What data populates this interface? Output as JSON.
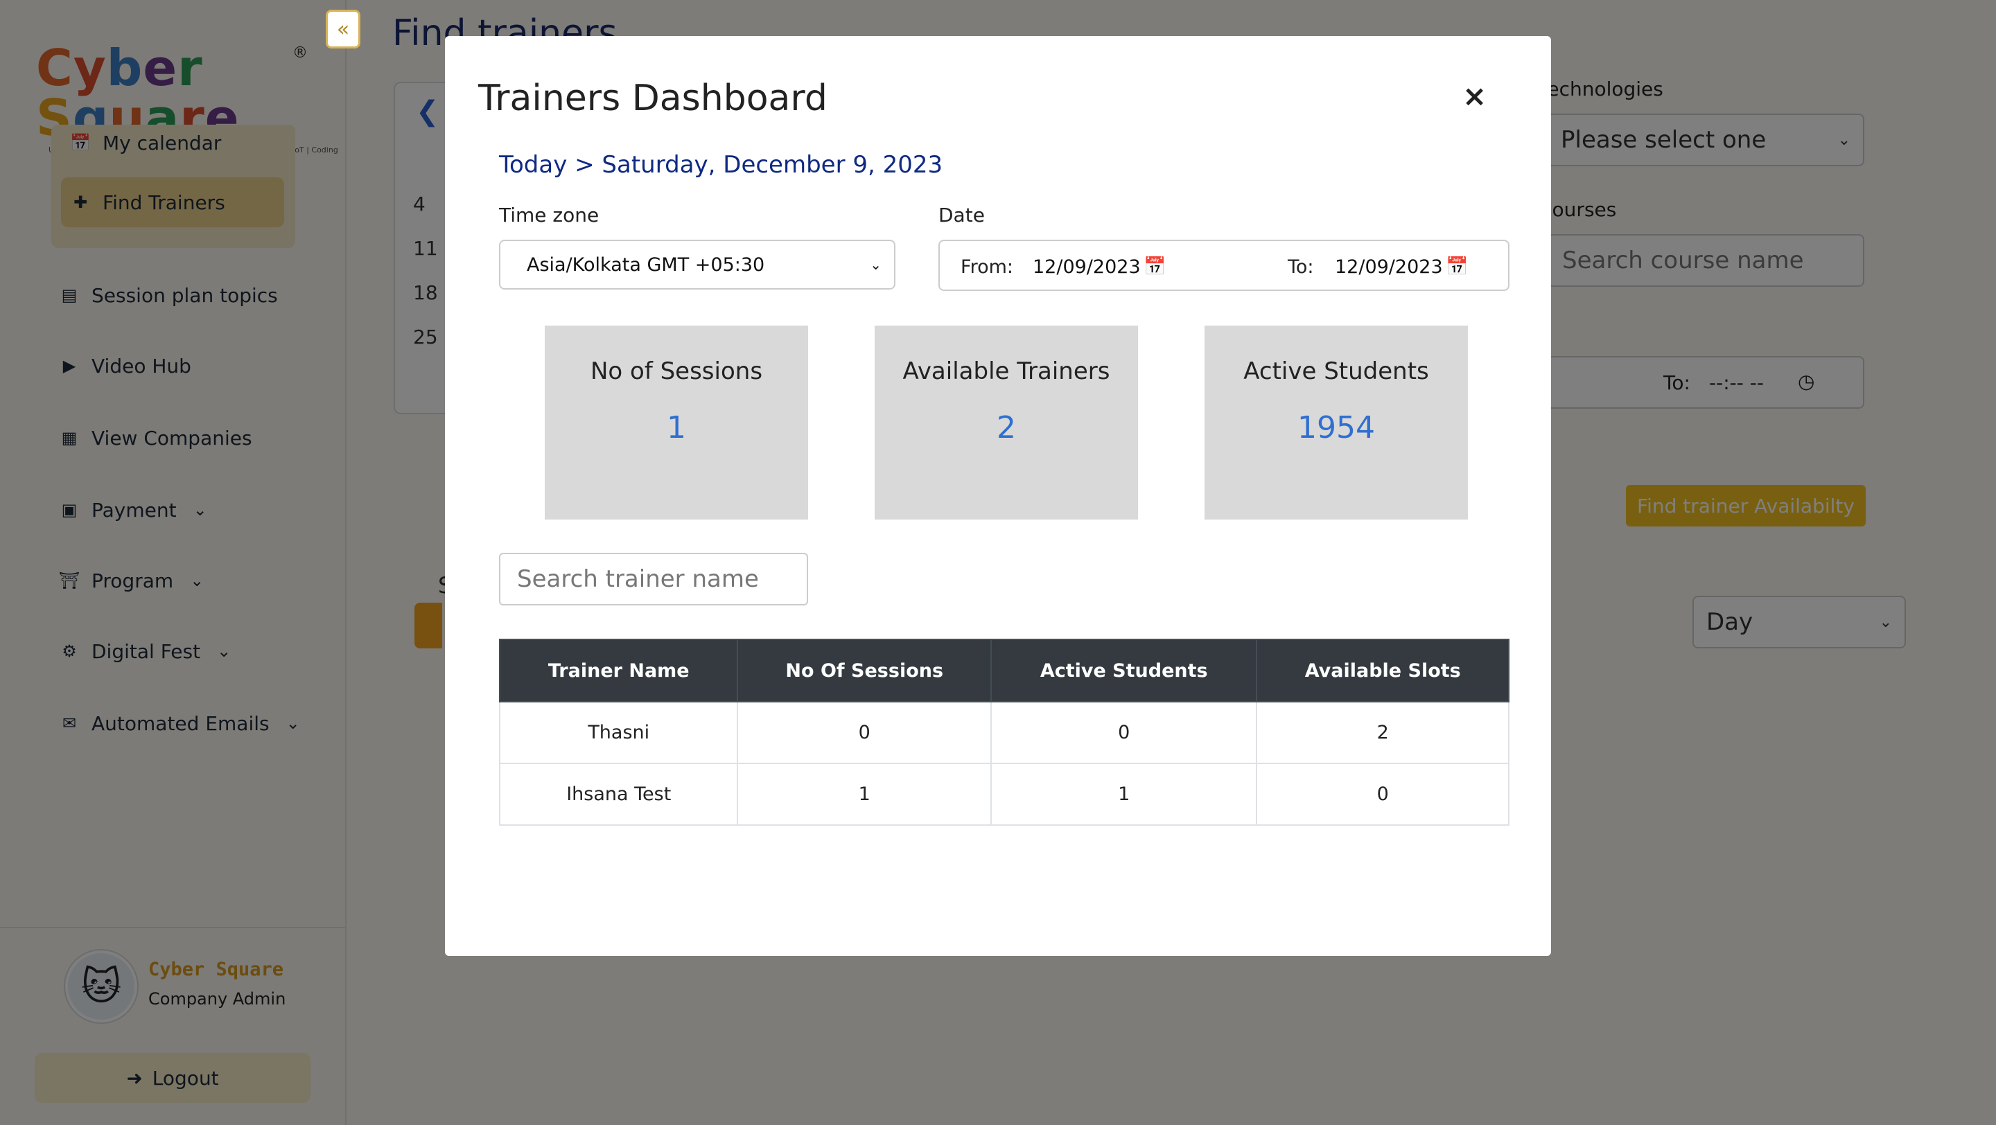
{
  "sidebar": {
    "logo_text": "Cyber Square",
    "logo_reg": "®",
    "logo_tagline": "Users to Creators: Metaverse | Artificial Intelligence | Robotics | IoT | Coding",
    "items": [
      {
        "label": "My calendar",
        "icon": "calendar-icon"
      },
      {
        "label": "Find Trainers",
        "icon": "user-plus-icon"
      },
      {
        "label": "Session plan topics",
        "icon": "document-icon"
      },
      {
        "label": "Video Hub",
        "icon": "video-icon"
      },
      {
        "label": "View Companies",
        "icon": "building-icon"
      },
      {
        "label": "Payment",
        "icon": "briefcase-icon"
      },
      {
        "label": "Program",
        "icon": "institution-icon"
      },
      {
        "label": "Digital Fest",
        "icon": "gear-icon"
      },
      {
        "label": "Automated Emails",
        "icon": "envelope-icon"
      }
    ],
    "profile": {
      "name": "Cyber Square",
      "role": "Company Admin"
    },
    "logout_label": "Logout"
  },
  "main": {
    "page_title": "Find trainers",
    "calendar_days": [
      "4",
      "11",
      "18",
      "25"
    ],
    "technologies_label": "Technologies",
    "technologies_value": "Please select one",
    "courses_label": "Courses",
    "courses_placeholder": "Search course name",
    "time_to_label": "To:",
    "time_to_value": "--:-- --",
    "find_button": "Find trainer Availabilty",
    "view_select": "Day",
    "s_char": "S"
  },
  "modal": {
    "title": "Trainers Dashboard",
    "close_symbol": "×",
    "breadcrumb": "Today > Saturday, December 9, 2023",
    "timezone_label": "Time zone",
    "timezone_value": "Asia/Kolkata GMT +05:30",
    "date_label": "Date",
    "from_label": "From:",
    "from_value": "12/09/2023",
    "to_label": "To:",
    "to_value": "12/09/2023",
    "stats": [
      {
        "label": "No of Sessions",
        "value": "1"
      },
      {
        "label": "Available Trainers",
        "value": "2"
      },
      {
        "label": "Active Students",
        "value": "1954"
      }
    ],
    "search_placeholder": "Search trainer name",
    "table": {
      "headers": [
        "Trainer Name",
        "No Of Sessions",
        "Active Students",
        "Available Slots"
      ],
      "rows": [
        [
          "Thasni",
          "0",
          "0",
          "2"
        ],
        [
          "Ihsana Test",
          "1",
          "1",
          "0"
        ]
      ]
    }
  },
  "colors": {
    "accent_gold": "#f0c020",
    "primary_blue": "#2f6fd0",
    "navy": "#0f2a82",
    "table_header": "#343a40"
  }
}
